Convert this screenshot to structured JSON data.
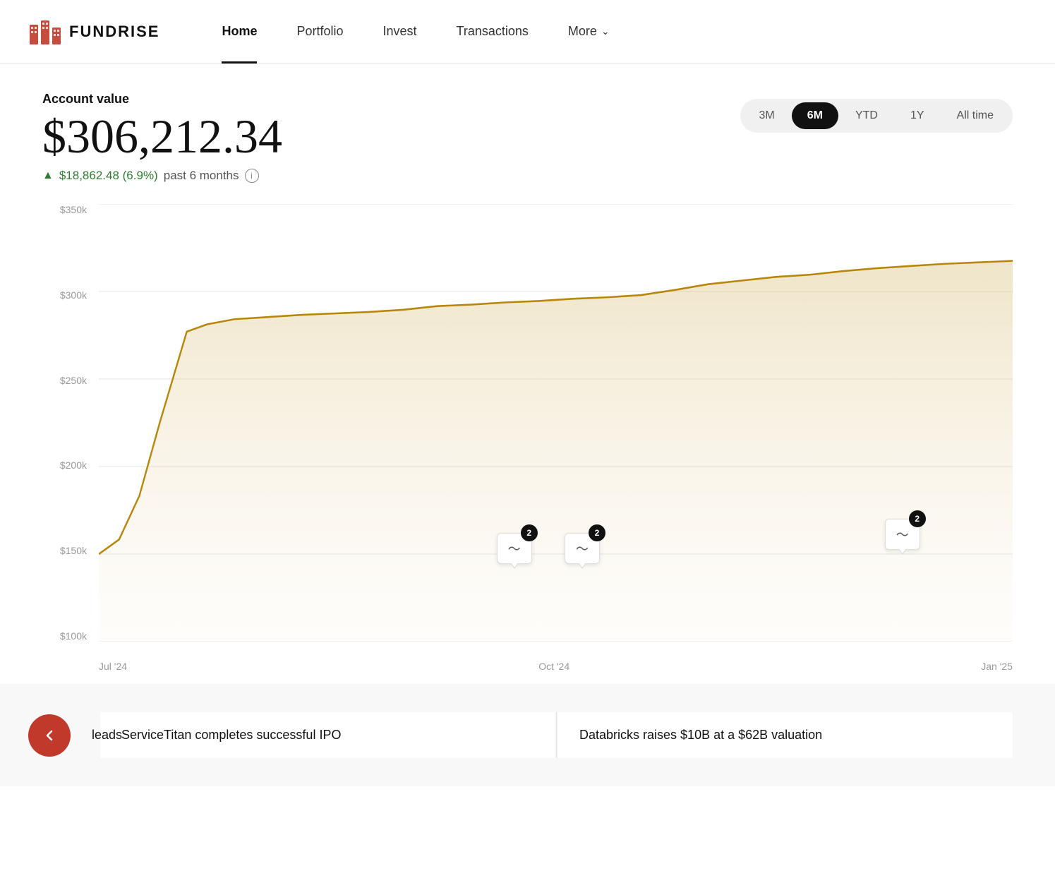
{
  "logo": {
    "text": "FUNDRISE"
  },
  "nav": {
    "links": [
      {
        "label": "Home",
        "active": true
      },
      {
        "label": "Portfolio",
        "active": false
      },
      {
        "label": "Invest",
        "active": false
      },
      {
        "label": "Transactions",
        "active": false
      },
      {
        "label": "More",
        "active": false,
        "hasChevron": true
      }
    ]
  },
  "accountValue": {
    "label": "Account value",
    "amount": "$306,212.34",
    "change": "$18,862.48 (6.9%)",
    "period": "past 6 months"
  },
  "timeRange": {
    "options": [
      "3M",
      "6M",
      "YTD",
      "1Y",
      "All time"
    ],
    "active": "6M"
  },
  "chart": {
    "yLabels": [
      "$350k",
      "$300k",
      "$250k",
      "$200k",
      "$150k",
      "$100k"
    ],
    "xLabels": [
      "Jul '24",
      "Oct '24",
      "Jan '25"
    ],
    "lineColor": "#b8860b",
    "fillColor": "rgba(210, 180, 130, 0.25)"
  },
  "eventMarkers": [
    {
      "badge": "2",
      "left": "42%"
    },
    {
      "badge": "2",
      "left": "49%"
    },
    {
      "badge": "2",
      "left": "82%"
    }
  ],
  "news": {
    "partialLeft": "leads",
    "items": [
      {
        "title": "ServiceTitan completes successful IPO"
      },
      {
        "title": "Databricks raises $10B at a $62B valuation"
      }
    ]
  }
}
